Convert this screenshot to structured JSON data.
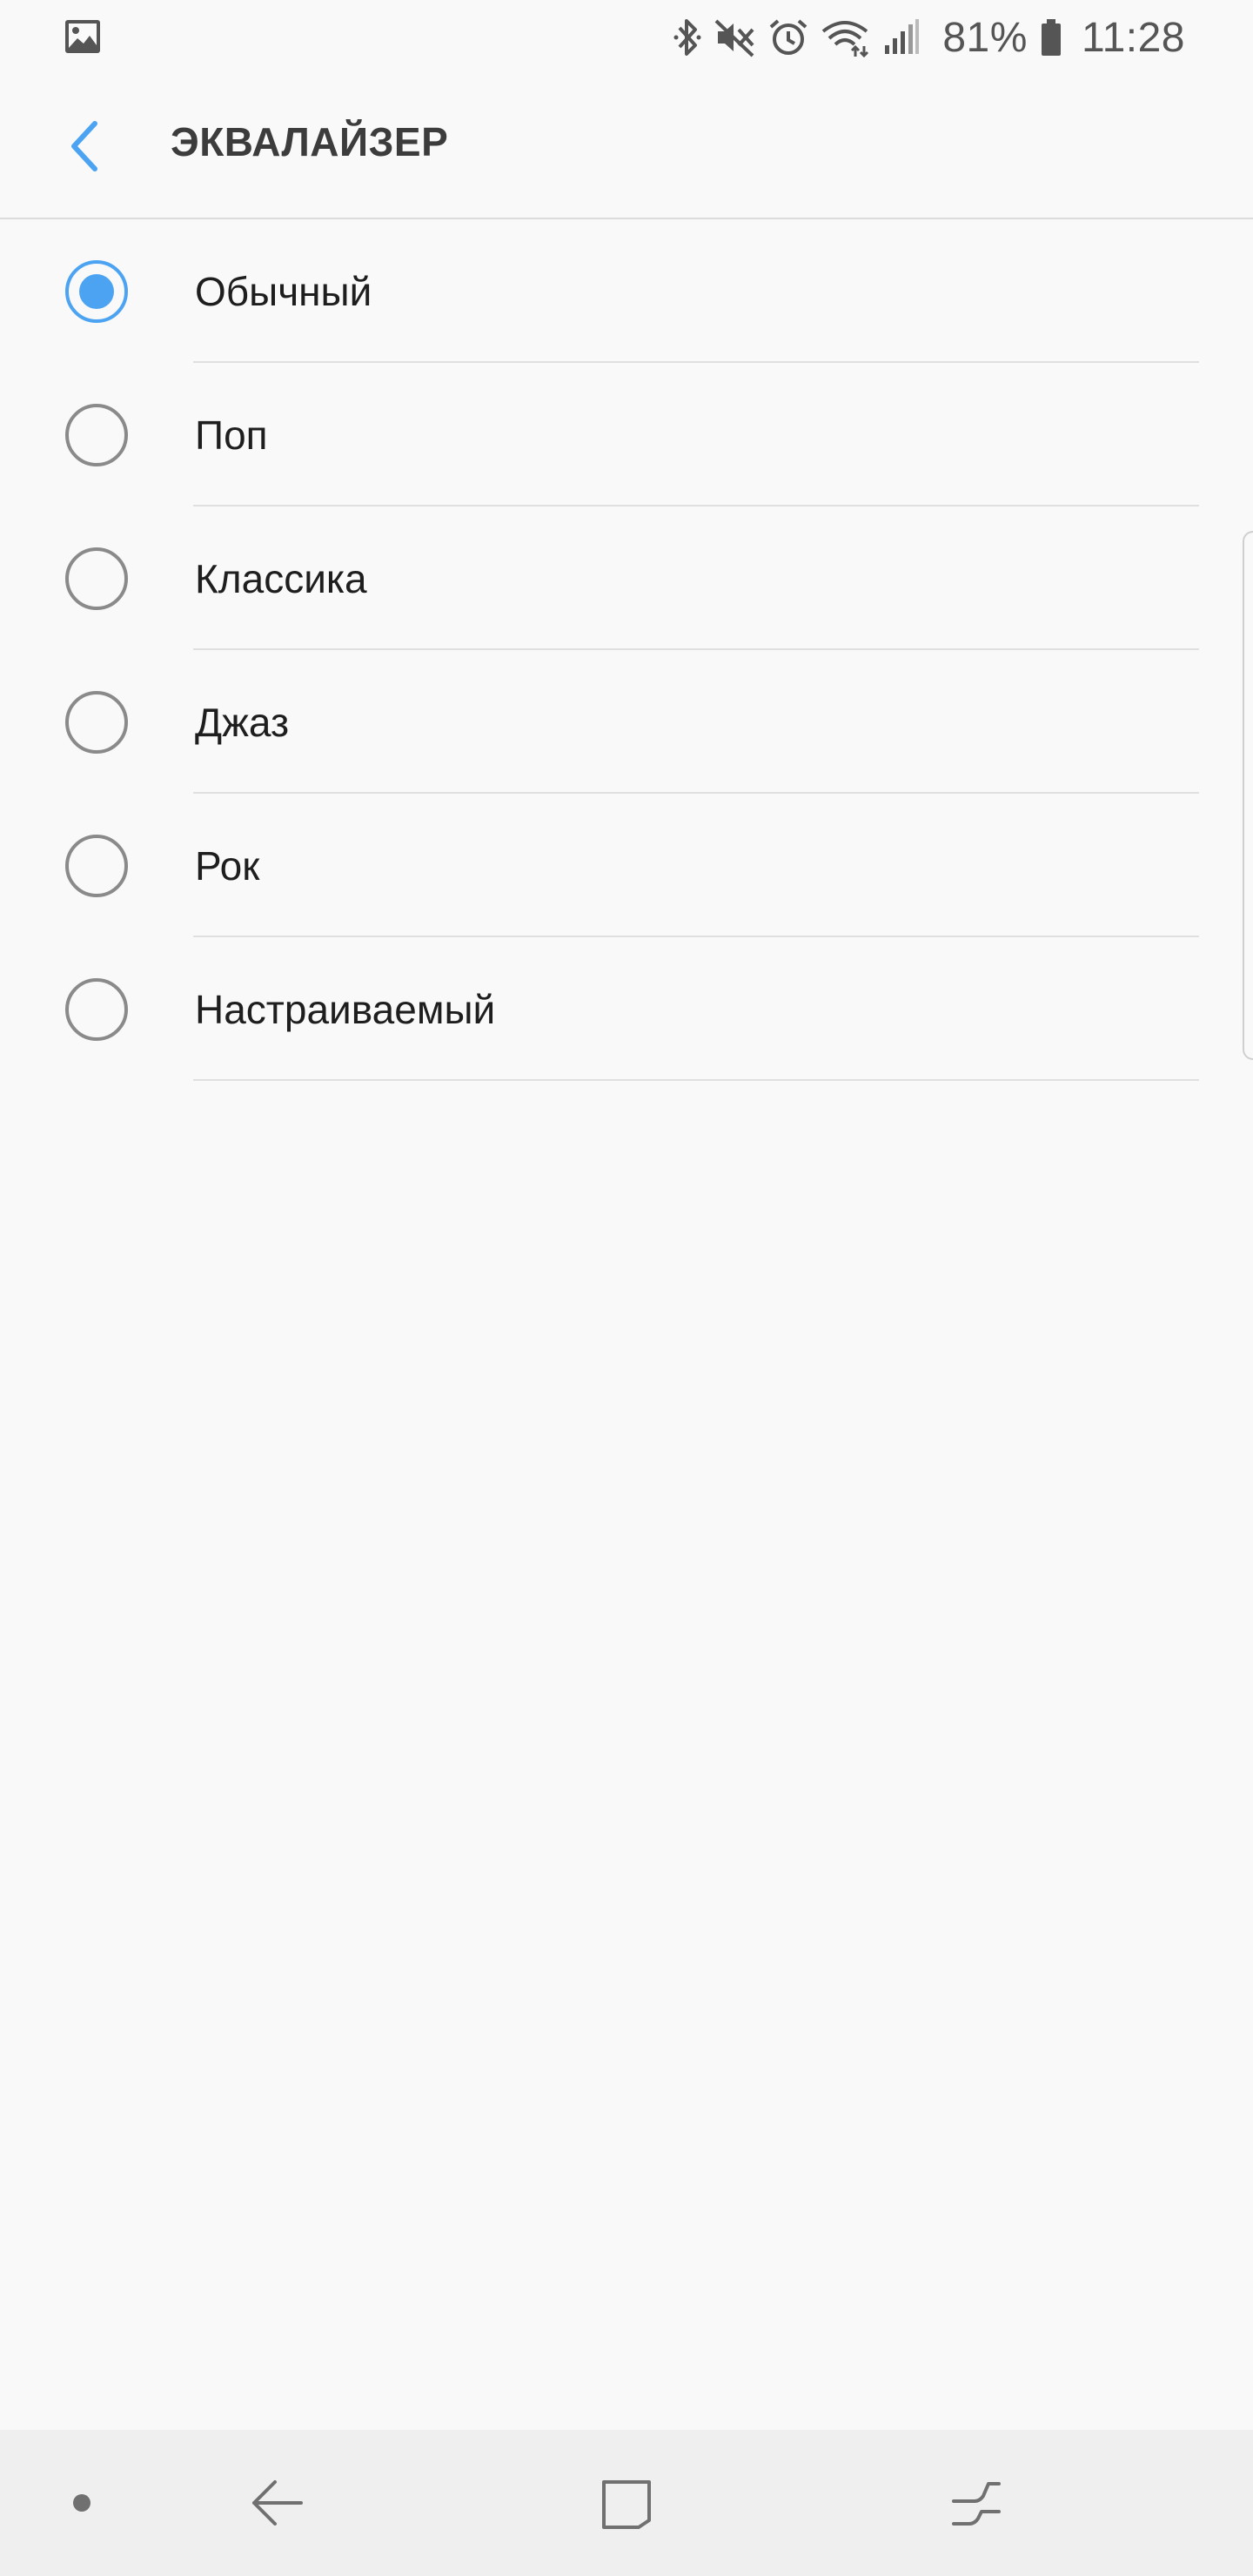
{
  "status_bar": {
    "battery_percent": "81%",
    "time": "11:28",
    "icons": [
      "gallery-icon",
      "bluetooth-icon",
      "mute-icon",
      "alarm-icon",
      "wifi-icon",
      "signal-icon",
      "battery-icon"
    ]
  },
  "app_bar": {
    "title": "ЭКВАЛАЙЗЕР",
    "back_icon": "chevron-left-icon"
  },
  "equalizer": {
    "selected_index": 0,
    "options": [
      {
        "label": "Обычный",
        "selected": true
      },
      {
        "label": "Поп",
        "selected": false
      },
      {
        "label": "Классика",
        "selected": false
      },
      {
        "label": "Джаз",
        "selected": false
      },
      {
        "label": "Рок",
        "selected": false
      },
      {
        "label": "Настраиваемый",
        "selected": false
      }
    ]
  },
  "nav_bar": {
    "buttons": [
      "dot-icon",
      "back-arrow-icon",
      "recents-icon",
      "switch-icon"
    ]
  },
  "colors": {
    "accent": "#4ba3f2",
    "background": "#f9f9f9",
    "nav_background": "#efefef",
    "divider": "#e0e0e0"
  }
}
